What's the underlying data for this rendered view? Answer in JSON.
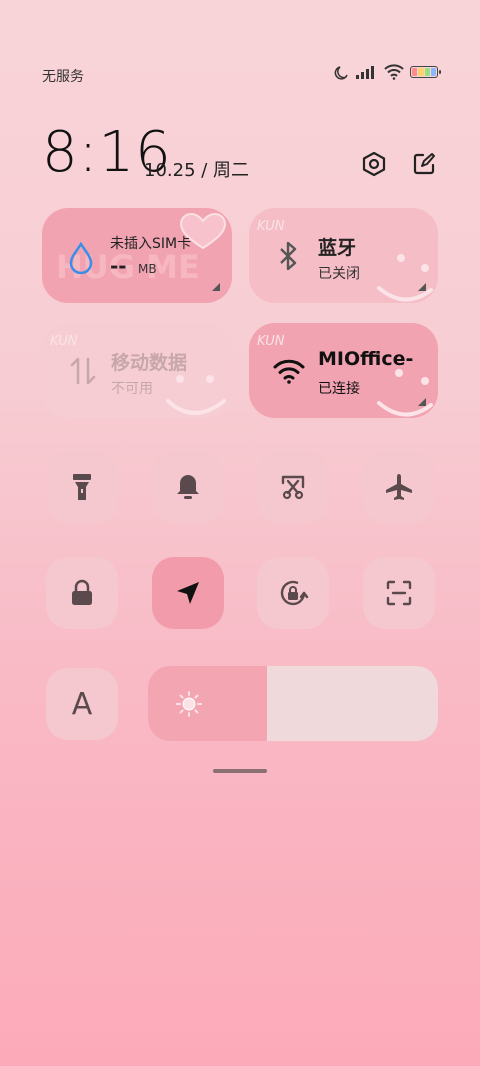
{
  "status_bar": {
    "carrier": "无服务",
    "icons": [
      "moon-icon",
      "signal-icon",
      "wifi-icon",
      "battery-icon"
    ]
  },
  "header": {
    "time": "8:16",
    "date": "10.25 / 周二",
    "actions": [
      "settings-icon",
      "edit-icon"
    ]
  },
  "tiles": {
    "data_usage": {
      "title": "未插入SIM卡",
      "value": "--",
      "unit": "MB",
      "icon": "water-drop-icon",
      "deco_text": "HUG ME"
    },
    "bluetooth": {
      "title": "蓝牙",
      "status": "已关闭",
      "icon": "bluetooth-icon",
      "deco_text": "KUN"
    },
    "mobile_data": {
      "title": "移动数据",
      "status": "不可用",
      "icon": "mobile-data-icon",
      "deco_text": "KUN"
    },
    "wifi": {
      "title": "MIOffice-",
      "status": "已连接",
      "icon": "wifi-icon",
      "deco_text": "KUN"
    }
  },
  "toggles_row1": [
    "flashlight-icon",
    "bell-icon",
    "screenshot-icon",
    "airplane-icon"
  ],
  "toggles_row2": [
    "lock-icon",
    "location-icon",
    "rotation-lock-icon",
    "scan-icon"
  ],
  "font_button": {
    "label": "A"
  },
  "brightness": {
    "level": 0.41
  },
  "colors": {
    "active_tile": "#f2a3b1",
    "inactive_tile": "#f5c7ce",
    "accent_blue": "#3b8ee8"
  }
}
